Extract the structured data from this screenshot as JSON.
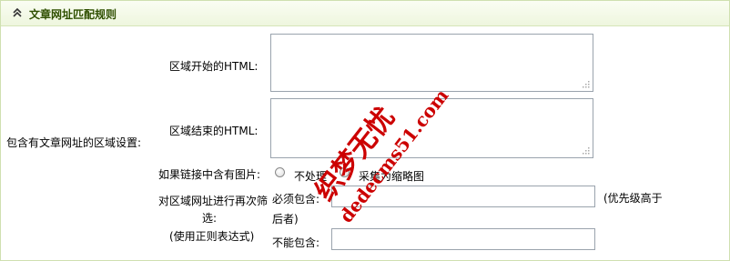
{
  "section": {
    "title": "文章网址匹配规则"
  },
  "group_label": "包含有文章网址的区域设置:",
  "area_start_label": "区域开始的HTML:",
  "area_end_label": "区域结束的HTML:",
  "image_option": {
    "label": "如果链接中含有图片:",
    "options": [
      "不处理",
      "采集为缩略图"
    ]
  },
  "filter": {
    "label_line1": "对区域网址进行再次筛",
    "label_line2": "选:",
    "label_line3": "(使用正则表达式)",
    "must_include_label": "必须包含:",
    "priority_note_line1": "(优先级高于",
    "priority_note_line2": "后者)",
    "must_not_include_label": "不能包含:"
  },
  "watermark": {
    "text1": "织梦无忧",
    "text2": "dedecms51.com",
    "color": "#cc0000"
  }
}
